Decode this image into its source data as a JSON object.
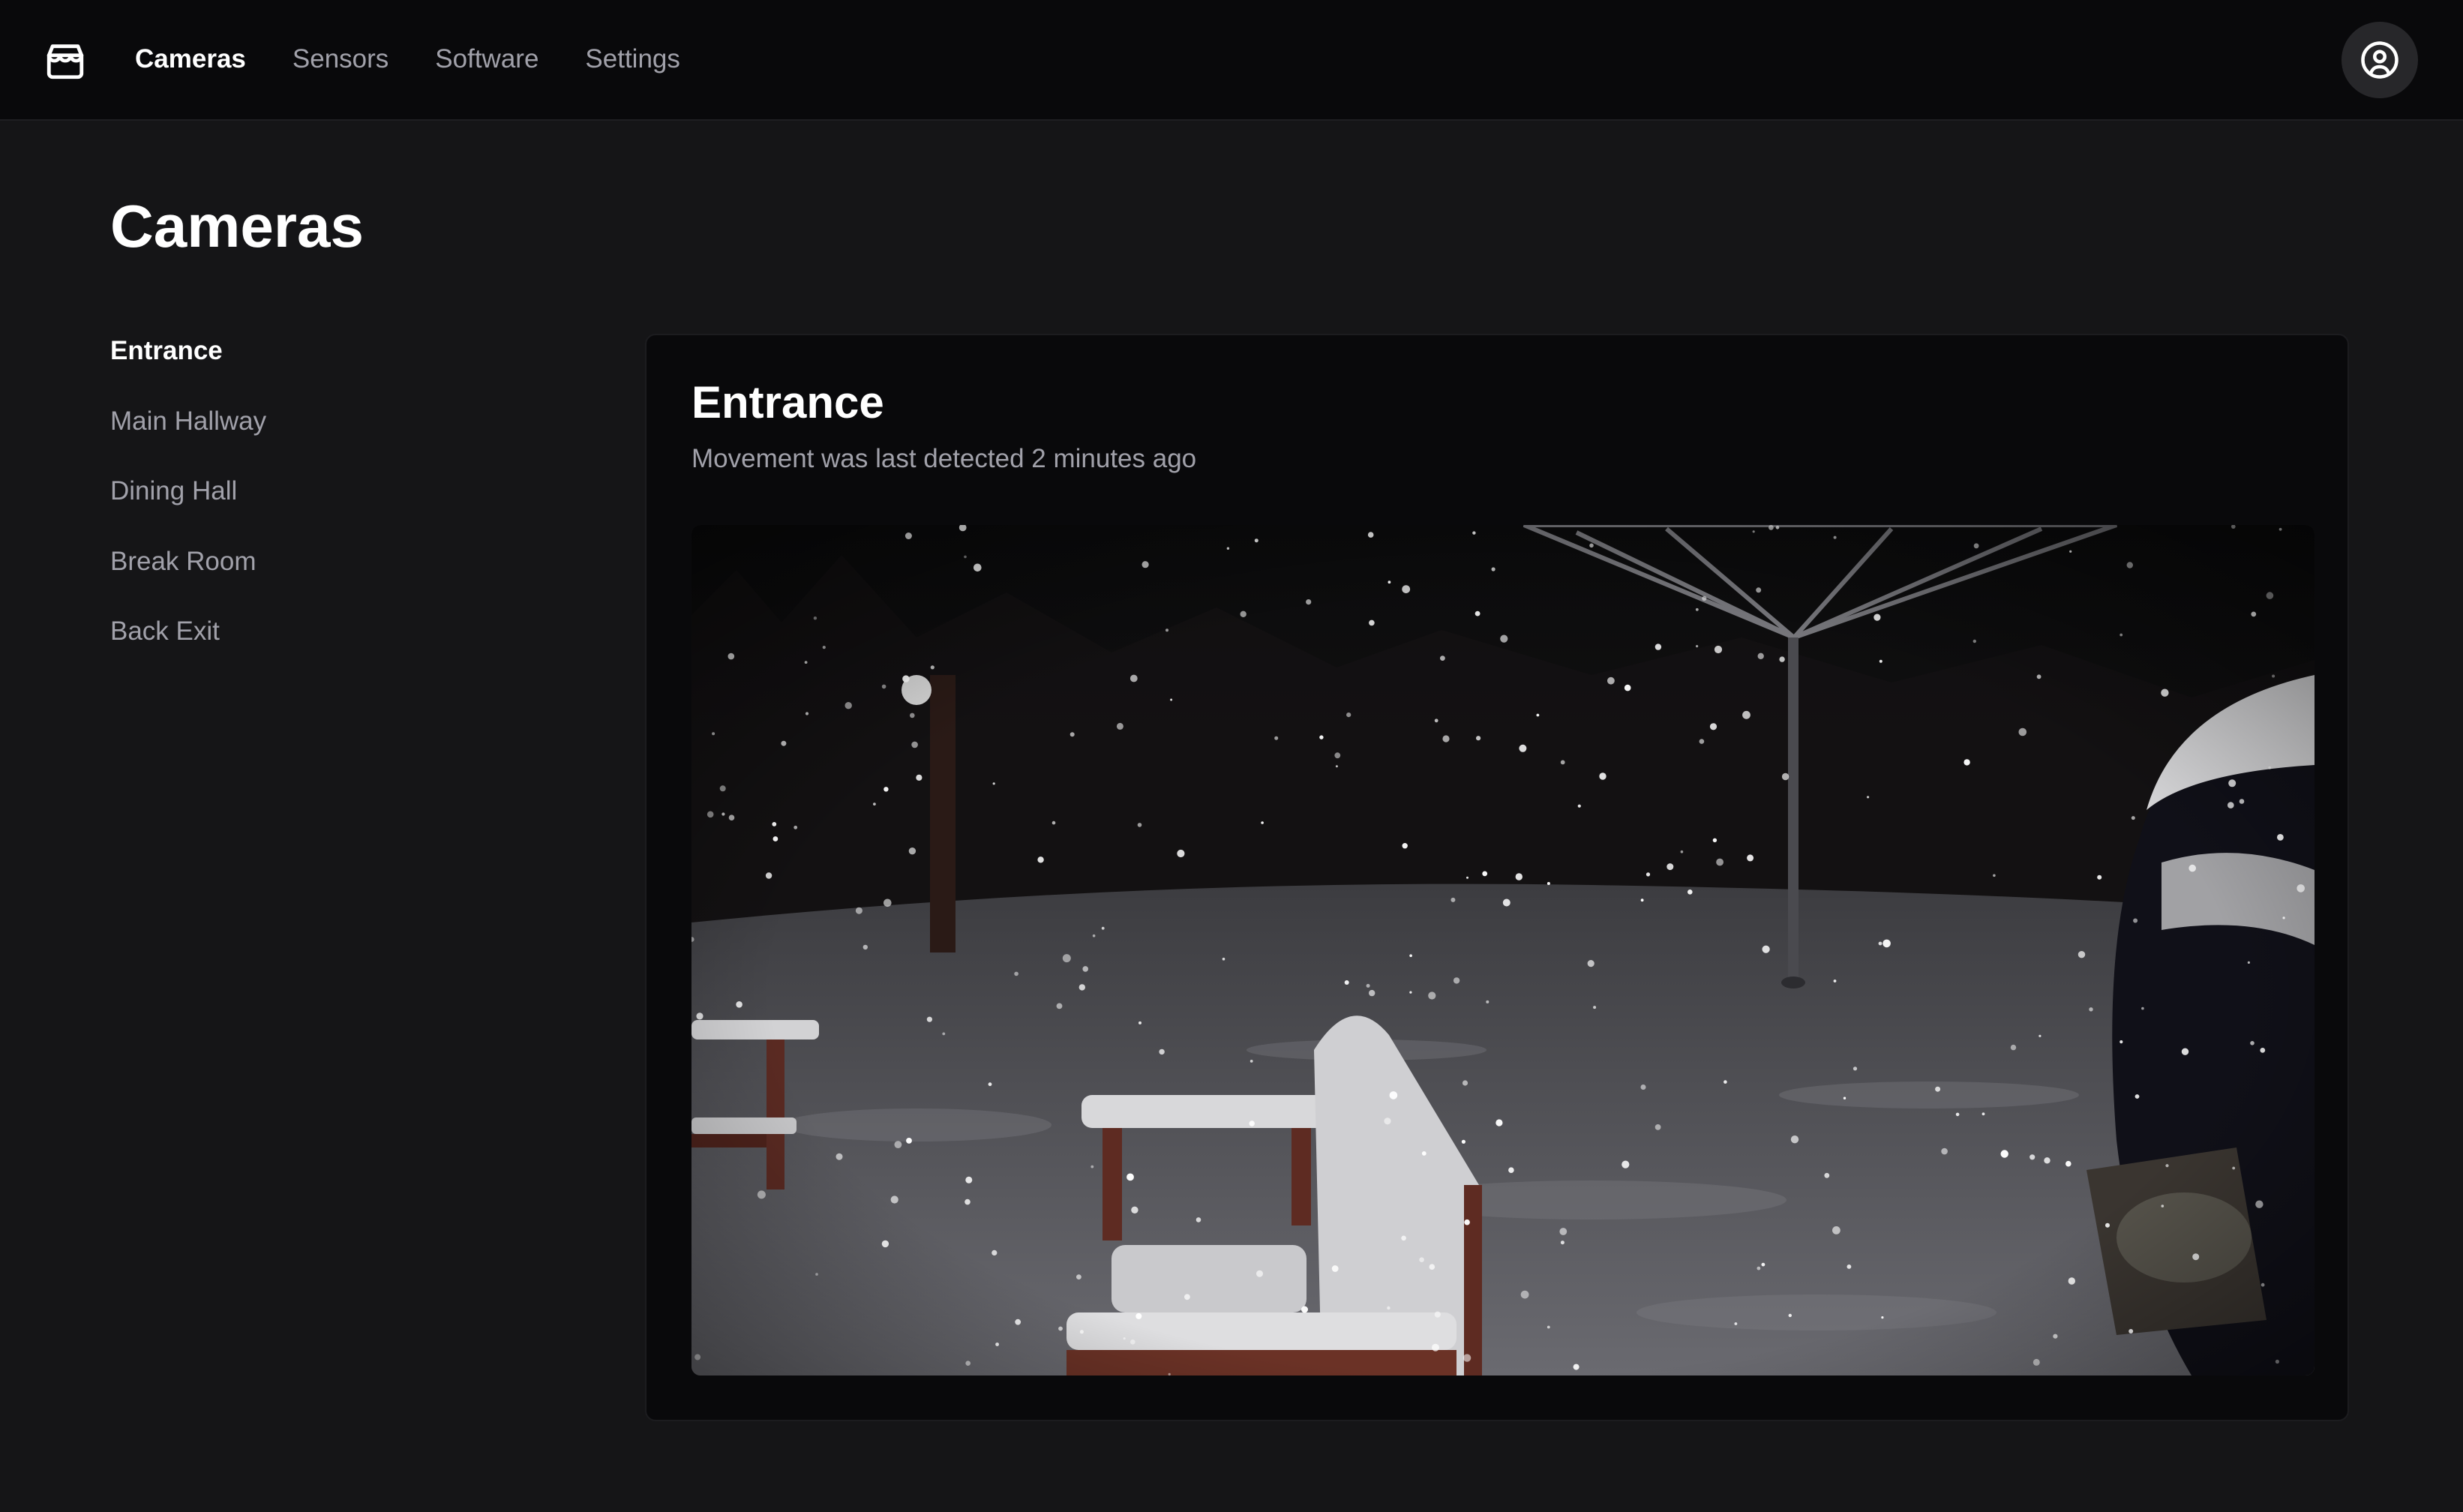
{
  "app": {
    "logo_icon": "store-icon"
  },
  "nav": {
    "items": [
      {
        "label": "Cameras",
        "active": true
      },
      {
        "label": "Sensors",
        "active": false
      },
      {
        "label": "Software",
        "active": false
      },
      {
        "label": "Settings",
        "active": false
      }
    ],
    "account_icon": "user-circle-icon"
  },
  "page": {
    "title": "Cameras"
  },
  "sidebar": {
    "items": [
      {
        "label": "Entrance",
        "active": true
      },
      {
        "label": "Main Hallway",
        "active": false
      },
      {
        "label": "Dining Hall",
        "active": false
      },
      {
        "label": "Break Room",
        "active": false
      },
      {
        "label": "Back Exit",
        "active": false
      }
    ]
  },
  "camera": {
    "title": "Entrance",
    "status": "Movement was last detected 2 minutes ago",
    "feed_description": "Night view of a snowy backyard with snow-covered wooden benches and a rotary clothesline"
  },
  "colors": {
    "background": "#151517",
    "topbar": "#09090b",
    "card": "#09090b",
    "text_primary": "#ffffff",
    "text_muted": "#a1a1aa",
    "account_button": "#27272a"
  }
}
